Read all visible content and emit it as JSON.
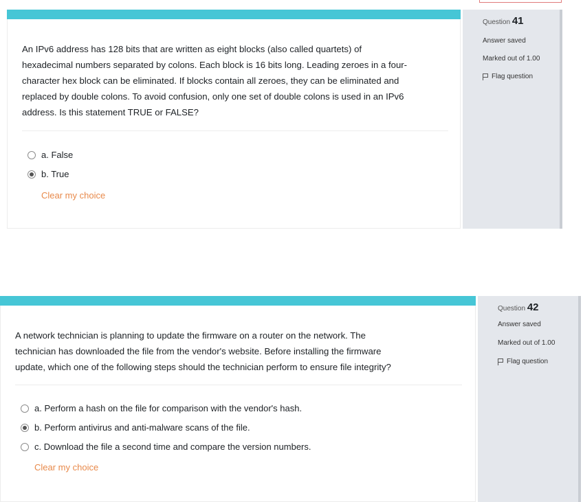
{
  "questions": [
    {
      "number": "41",
      "number_label": "Question",
      "status": "Answer saved",
      "marks": "Marked out of 1.00",
      "flag_label": "Flag question",
      "text_lines": [
        "An IPv6 address has 128 bits that are written as eight blocks (also called quartets) of",
        "hexadecimal numbers separated by colons. Each block is 16 bits long. Leading zeroes in a four-",
        "character hex block can be eliminated. If blocks contain all zeroes, they can be eliminated and",
        "replaced by double colons. To avoid confusion, only one set of double colons is used in an IPv6",
        "address. Is this statement TRUE or FALSE?"
      ],
      "options": [
        {
          "label": "a. False",
          "selected": false
        },
        {
          "label": "b. True",
          "selected": true
        }
      ],
      "clear_label": "Clear my choice"
    },
    {
      "number": "42",
      "number_label": "Question",
      "status": "Answer saved",
      "marks": "Marked out of 1.00",
      "flag_label": "Flag question",
      "text_lines": [
        "A network technician is planning to update the firmware on a router on the network. The",
        "technician has downloaded the file from the vendor's website. Before installing the firmware",
        "update, which one of the following steps should the technician perform to ensure file integrity?"
      ],
      "options": [
        {
          "label": "a. Perform a hash on the file for comparison with the vendor's hash.",
          "selected": false
        },
        {
          "label": "b. Perform antivirus and anti-malware scans of the file.",
          "selected": true
        },
        {
          "label": "c. Download the file a second time and compare the version numbers.",
          "selected": false
        }
      ],
      "clear_label": "Clear my choice"
    }
  ],
  "colors": {
    "accent_bar": "#46c6d6",
    "clear_link": "#e8894a",
    "info_panel": "#e4e7ec"
  }
}
